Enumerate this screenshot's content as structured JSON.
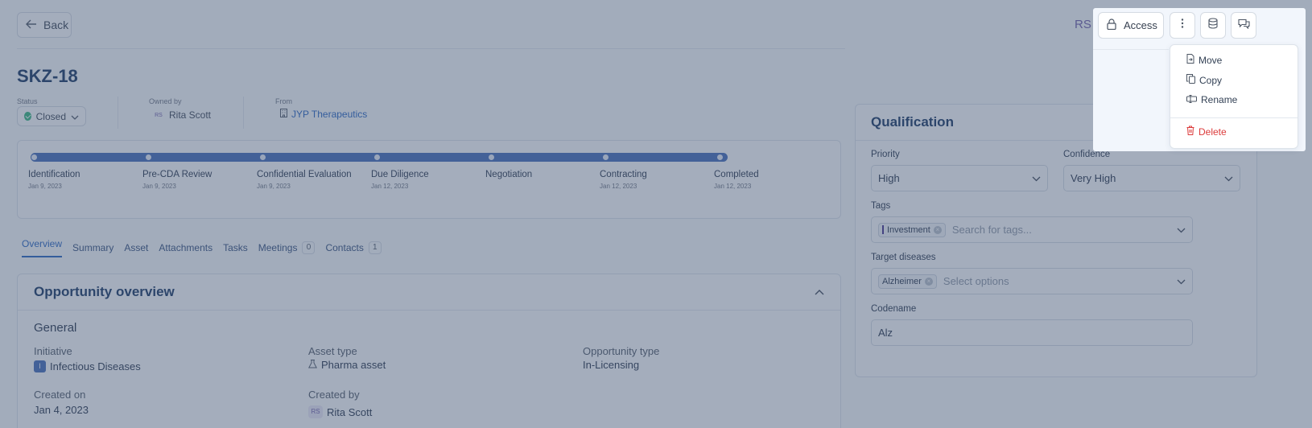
{
  "header": {
    "back_label": "Back",
    "user_initials": "RS",
    "title": "SKZ-18"
  },
  "meta": {
    "status_label": "Status",
    "status_value": "Closed",
    "owner_label": "Owned by",
    "owner_initials": "RS",
    "owner_name": "Rita Scott",
    "from_label": "From",
    "from_value": "JYP Therapeutics"
  },
  "stages": [
    {
      "name": "Identification",
      "date": "Jan 9, 2023"
    },
    {
      "name": "Pre-CDA Review",
      "date": "Jan 9, 2023"
    },
    {
      "name": "Confidential Evaluation",
      "date": "Jan 9, 2023"
    },
    {
      "name": "Due Diligence",
      "date": "Jan 12, 2023"
    },
    {
      "name": "Negotiation",
      "date": ""
    },
    {
      "name": "Contracting",
      "date": "Jan 12, 2023"
    },
    {
      "name": "Completed",
      "date": "Jan 12, 2023"
    }
  ],
  "tabs": {
    "overview": "Overview",
    "summary": "Summary",
    "asset": "Asset",
    "attachments": "Attachments",
    "tasks": "Tasks",
    "meetings": "Meetings",
    "meetings_count": "0",
    "contacts": "Contacts",
    "contacts_count": "1"
  },
  "overview": {
    "title": "Opportunity overview",
    "section": "General",
    "initiative_label": "Initiative",
    "initiative_badge": "I",
    "initiative_value": "Infectious Diseases",
    "asset_type_label": "Asset type",
    "asset_type_value": "Pharma asset",
    "opportunity_type_label": "Opportunity type",
    "opportunity_type_value": "In-Licensing",
    "created_on_label": "Created on",
    "created_on_value": "Jan 4, 2023",
    "created_by_label": "Created by",
    "created_by_initials": "RS",
    "created_by_value": "Rita Scott"
  },
  "qualification": {
    "title": "Qualification",
    "priority_label": "Priority",
    "priority_value": "High",
    "confidence_label": "Confidence",
    "confidence_value": "Very High",
    "tags_label": "Tags",
    "tag_chip": "Investment",
    "tags_placeholder": "Search for tags...",
    "diseases_label": "Target diseases",
    "disease_chip": "Alzheimer",
    "diseases_placeholder": "Select options",
    "codename_label": "Codename",
    "codename_value": "Alz"
  },
  "actions": {
    "access_label": "Access"
  },
  "menu": {
    "move": "Move",
    "copy": "Copy",
    "rename": "Rename",
    "delete": "Delete"
  },
  "colors": {
    "accent": "#1f5fbf",
    "title": "#0f2f5c",
    "danger": "#dc3b3b",
    "status_closed": "#2fb57a",
    "overlay": "#495c7a"
  }
}
